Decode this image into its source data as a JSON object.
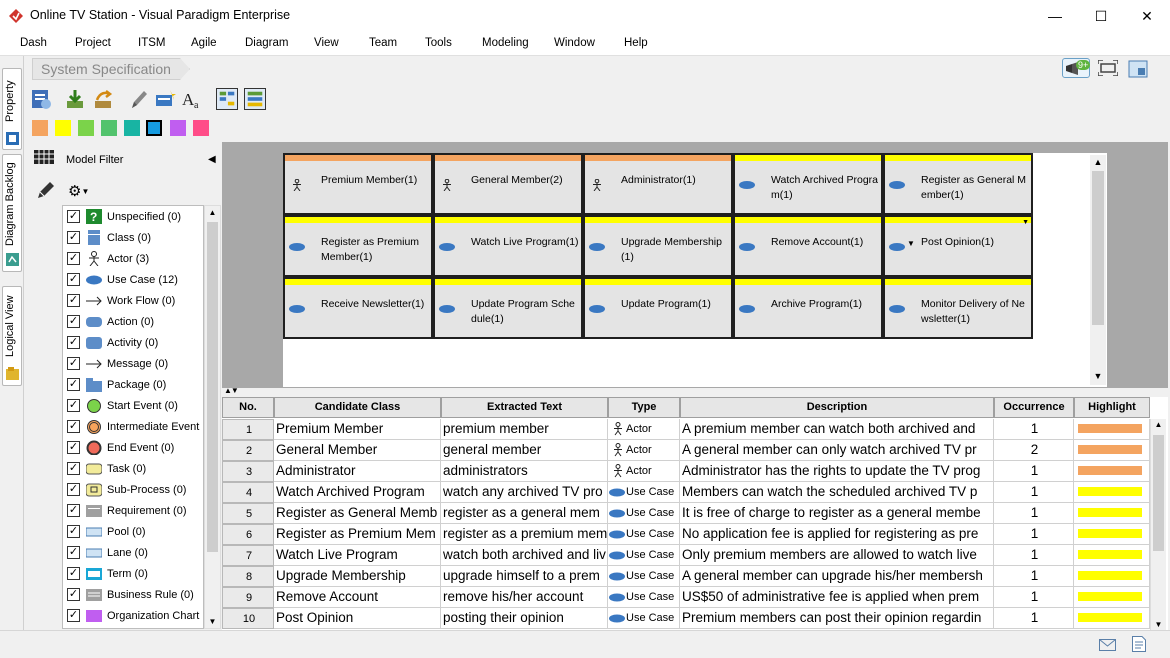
{
  "window": {
    "title": "Online TV Station - Visual Paradigm Enterprise",
    "minimize": "—",
    "maximize": "☐",
    "close": "✕"
  },
  "menu": [
    "Dash",
    "Project",
    "ITSM",
    "Agile",
    "Diagram",
    "View",
    "Team",
    "Tools",
    "Modeling",
    "Window",
    "Help"
  ],
  "left_tabs": {
    "property": "Property",
    "diagram_backlog": "Diagram Backlog",
    "logical_view": "Logical View"
  },
  "breadcrumb": "System Specification",
  "notification_badge": "9+",
  "swatches": [
    "#f4a460",
    "#ffff00",
    "#7bd34a",
    "#52c36d",
    "#18b4a3",
    "#169be0",
    "#c05ef0",
    "#ff4d88"
  ],
  "filter": {
    "title": "Model Filter",
    "items": [
      {
        "label": "Unspecified (0)",
        "icon": "question-icon"
      },
      {
        "label": "Class (0)",
        "icon": "class-icon"
      },
      {
        "label": "Actor (3)",
        "icon": "actor-icon"
      },
      {
        "label": "Use Case (12)",
        "icon": "use-case-icon"
      },
      {
        "label": "Work Flow (0)",
        "icon": "arrow-icon"
      },
      {
        "label": "Action (0)",
        "icon": "action-icon"
      },
      {
        "label": "Activity (0)",
        "icon": "activity-icon"
      },
      {
        "label": "Message (0)",
        "icon": "message-icon"
      },
      {
        "label": "Package (0)",
        "icon": "package-icon"
      },
      {
        "label": "Start Event (0)",
        "icon": "start-event-icon"
      },
      {
        "label": "Intermediate Event (0)",
        "icon": "intermediate-event-icon"
      },
      {
        "label": "End Event (0)",
        "icon": "end-event-icon"
      },
      {
        "label": "Task (0)",
        "icon": "task-icon"
      },
      {
        "label": "Sub-Process (0)",
        "icon": "sub-process-icon"
      },
      {
        "label": "Requirement (0)",
        "icon": "requirement-icon"
      },
      {
        "label": "Pool (0)",
        "icon": "pool-icon"
      },
      {
        "label": "Lane (0)",
        "icon": "lane-icon"
      },
      {
        "label": "Term (0)",
        "icon": "term-icon"
      },
      {
        "label": "Business Rule (0)",
        "icon": "business-rule-icon"
      },
      {
        "label": "Organization Chart (",
        "icon": "org-chart-icon"
      }
    ]
  },
  "cells": [
    {
      "text": "Premium Member(1)",
      "type": "actor",
      "color": "#f4a460"
    },
    {
      "text": "General Member(2)",
      "type": "actor",
      "color": "#f4a460"
    },
    {
      "text": "Administrator(1)",
      "type": "actor",
      "color": "#f4a460"
    },
    {
      "text": "Watch Archived Program(1)",
      "type": "usecase",
      "color": "#ffff00"
    },
    {
      "text": "Register as General Member(1)",
      "type": "usecase",
      "color": "#ffff00"
    },
    {
      "text": "Register as Premium Member(1)",
      "type": "usecase",
      "color": "#ffff00"
    },
    {
      "text": "Watch Live Program(1)",
      "type": "usecase",
      "color": "#ffff00"
    },
    {
      "text": "Upgrade Membership(1)",
      "type": "usecase",
      "color": "#ffff00"
    },
    {
      "text": "Remove Account(1)",
      "type": "usecase",
      "color": "#ffff00"
    },
    {
      "text": "Post Opinion(1)",
      "type": "usecase",
      "color": "#ffff00"
    },
    {
      "text": "Receive Newsletter(1)",
      "type": "usecase",
      "color": "#ffff00"
    },
    {
      "text": "Update Program Schedule(1)",
      "type": "usecase",
      "color": "#ffff00"
    },
    {
      "text": "Update Program(1)",
      "type": "usecase",
      "color": "#ffff00"
    },
    {
      "text": "Archive Program(1)",
      "type": "usecase",
      "color": "#ffff00"
    },
    {
      "text": "Monitor Delivery of Newsletter(1)",
      "type": "usecase",
      "color": "#ffff00"
    }
  ],
  "table": {
    "headers": [
      "No.",
      "Candidate Class",
      "Extracted Text",
      "Type",
      "Description",
      "Occurrence",
      "Highlight"
    ],
    "rows": [
      {
        "no": "1",
        "cls": "Premium Member",
        "ext": "premium member",
        "type": "Actor",
        "desc": "A premium member can watch both archived and",
        "occ": "1",
        "color": "#f4a460"
      },
      {
        "no": "2",
        "cls": "General Member",
        "ext": "general member",
        "type": "Actor",
        "desc": "A general member can only watch archived TV pr",
        "occ": "2",
        "color": "#f4a460"
      },
      {
        "no": "3",
        "cls": "Administrator",
        "ext": "administrators",
        "type": "Actor",
        "desc": "Administrator has the rights to update the TV prog",
        "occ": "1",
        "color": "#f4a460"
      },
      {
        "no": "4",
        "cls": "Watch Archived Program",
        "ext": "watch any archived TV pro",
        "type": "Use Case",
        "desc": "Members can watch the scheduled archived TV p",
        "occ": "1",
        "color": "#ffff00"
      },
      {
        "no": "5",
        "cls": "Register as General Memb",
        "ext": "register as a general mem",
        "type": "Use Case",
        "desc": "It is free of charge to register as a general membe",
        "occ": "1",
        "color": "#ffff00"
      },
      {
        "no": "6",
        "cls": "Register as Premium Mem",
        "ext": "register as a premium mem",
        "type": "Use Case",
        "desc": "No application fee is applied for registering as pre",
        "occ": "1",
        "color": "#ffff00"
      },
      {
        "no": "7",
        "cls": "Watch Live Program",
        "ext": "watch both archived and liv",
        "type": "Use Case",
        "desc": "Only premium members are allowed to watch live",
        "occ": "1",
        "color": "#ffff00"
      },
      {
        "no": "8",
        "cls": "Upgrade Membership",
        "ext": "upgrade himself to a prem",
        "type": "Use Case",
        "desc": "A general member can upgrade his/her membersh",
        "occ": "1",
        "color": "#ffff00"
      },
      {
        "no": "9",
        "cls": "Remove Account",
        "ext": "remove his/her account",
        "type": "Use Case",
        "desc": "US$50 of administrative fee is applied when prem",
        "occ": "1",
        "color": "#ffff00"
      },
      {
        "no": "10",
        "cls": "Post Opinion",
        "ext": "posting their opinion",
        "type": "Use Case",
        "desc": "Premium members can post their opinion regardin",
        "occ": "1",
        "color": "#ffff00"
      }
    ]
  }
}
